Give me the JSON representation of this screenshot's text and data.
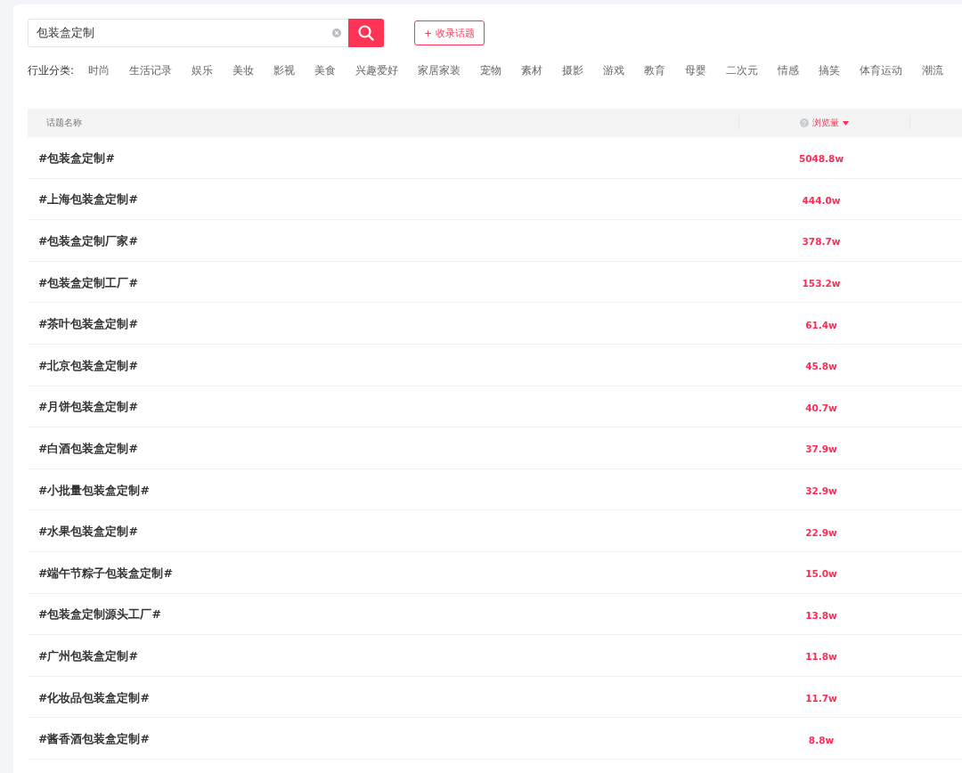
{
  "search": {
    "value": "包装盒定制"
  },
  "collect_button": "+ 收录话题",
  "categories": {
    "label": "行业分类:",
    "items": [
      "时尚",
      "生活记录",
      "娱乐",
      "美妆",
      "影视",
      "美食",
      "兴趣爱好",
      "家居家装",
      "宠物",
      "素材",
      "摄影",
      "游戏",
      "教育",
      "母婴",
      "二次元",
      "情感",
      "搞笑",
      "体育运动",
      "潮流"
    ]
  },
  "table": {
    "columns": [
      {
        "label": "话题名称",
        "kind": "name"
      },
      {
        "label": "浏览量",
        "kind": "metric",
        "sorted": true
      }
    ],
    "rows": [
      {
        "topic": "#包装盒定制#",
        "views": "5048.8w"
      },
      {
        "topic": "#上海包装盒定制#",
        "views": "444.0w"
      },
      {
        "topic": "#包装盒定制厂家#",
        "views": "378.7w"
      },
      {
        "topic": "#包装盒定制工厂#",
        "views": "153.2w"
      },
      {
        "topic": "#茶叶包装盒定制#",
        "views": "61.4w"
      },
      {
        "topic": "#北京包装盒定制#",
        "views": "45.8w"
      },
      {
        "topic": "#月饼包装盒定制#",
        "views": "40.7w"
      },
      {
        "topic": "#白酒包装盒定制#",
        "views": "37.9w"
      },
      {
        "topic": "#小批量包装盒定制#",
        "views": "32.9w"
      },
      {
        "topic": "#水果包装盒定制#",
        "views": "22.9w"
      },
      {
        "topic": "#端午节粽子包装盒定制#",
        "views": "15.0w"
      },
      {
        "topic": "#包装盒定制源头工厂#",
        "views": "13.8w"
      },
      {
        "topic": "#广州包装盒定制#",
        "views": "11.8w"
      },
      {
        "topic": "#化妆品包装盒定制#",
        "views": "11.7w"
      },
      {
        "topic": "#酱香酒包装盒定制#",
        "views": "8.8w"
      }
    ]
  }
}
